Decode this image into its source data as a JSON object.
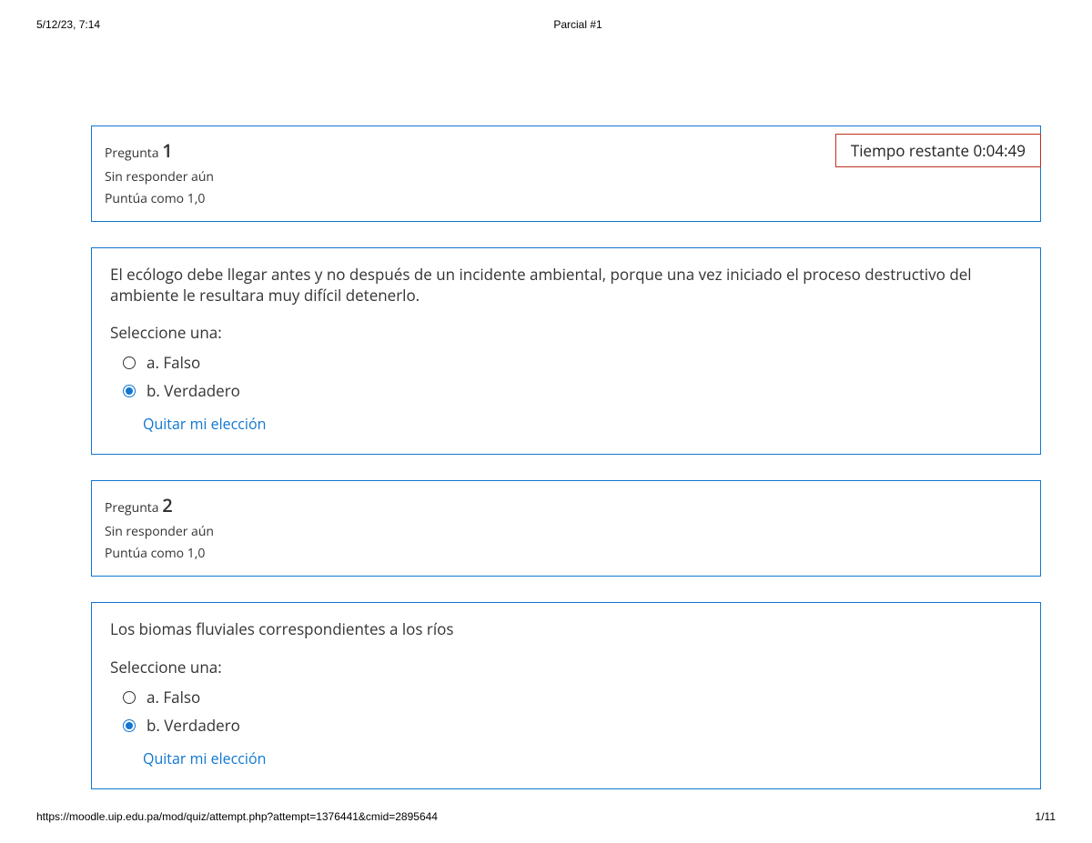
{
  "print": {
    "datetime": "5/12/23, 7:14",
    "title": "Parcial #1",
    "url": "https://moodle.uip.edu.pa/mod/quiz/attempt.php?attempt=1376441&cmid=2895644",
    "page": "1/11"
  },
  "labels": {
    "question": "Pregunta",
    "not_answered": "Sin responder aún",
    "points_as": "Puntúa como 1,0",
    "select_one": "Seleccione una:",
    "clear_choice": "Quitar mi elección"
  },
  "timer": {
    "label": "Tiempo restante",
    "value": "0:04:49"
  },
  "questions": [
    {
      "number": "1",
      "text": "El ecólogo debe llegar antes y no después de un incidente ambiental, porque una vez iniciado el proceso destructivo del ambiente le resultara muy difícil detenerlo.",
      "options": [
        {
          "letter": "a.",
          "label": "Falso",
          "checked": false
        },
        {
          "letter": "b.",
          "label": "Verdadero",
          "checked": true
        }
      ]
    },
    {
      "number": "2",
      "text": "Los biomas fluviales correspondientes a los ríos",
      "options": [
        {
          "letter": "a.",
          "label": "Falso",
          "checked": false
        },
        {
          "letter": "b.",
          "label": "Verdadero",
          "checked": true
        }
      ]
    }
  ]
}
